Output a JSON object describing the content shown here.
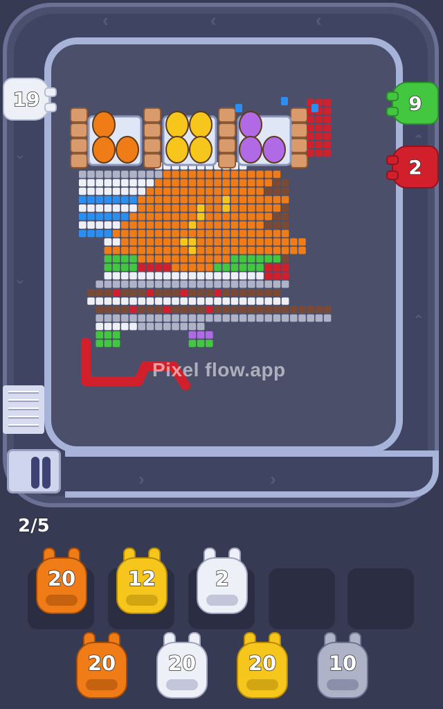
{
  "game": {
    "watermark": "Pixel flow.app",
    "progress": "2/5",
    "colors": {
      "orange": "#f07c17",
      "yellow": "#f7c61c",
      "white": "#eef0f8",
      "gray": "#aeb3c8",
      "red": "#d21f2c",
      "green": "#43c640",
      "blue": "#2a8ff0",
      "brown": "#7a4a35",
      "purple": "#b06ae6"
    },
    "track_shooters": [
      {
        "name": "track-shooter-white",
        "count": "19",
        "color": "white"
      },
      {
        "name": "track-shooter-green",
        "count": "9",
        "color": "green"
      },
      {
        "name": "track-shooter-red",
        "count": "2",
        "color": "red"
      }
    ],
    "active_slots": [
      {
        "count": "20",
        "color": "orange"
      },
      {
        "count": "12",
        "color": "yellow"
      },
      {
        "count": "2",
        "color": "white"
      },
      {
        "count": "",
        "color": "empty"
      },
      {
        "count": "",
        "color": "empty"
      }
    ],
    "queue": [
      {
        "count": "20",
        "color": "orange"
      },
      {
        "count": "20",
        "color": "white"
      },
      {
        "count": "20",
        "color": "yellow"
      },
      {
        "count": "10",
        "color": "gray"
      }
    ],
    "picture_subject": [
      "eggs-in-cartons",
      "roast-chicken-on-platter"
    ]
  }
}
